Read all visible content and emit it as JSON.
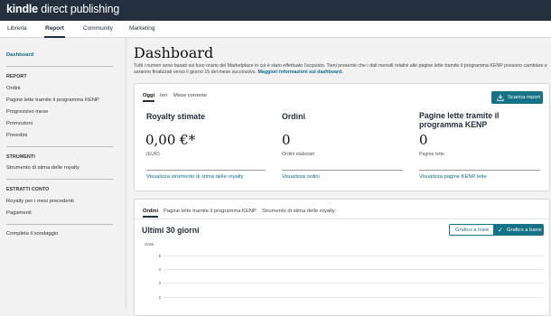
{
  "brand": {
    "bold": "kindle",
    "rest": " direct publishing"
  },
  "nav": {
    "tabs": [
      {
        "label": "Libreria"
      },
      {
        "label": "Report"
      },
      {
        "label": "Community"
      },
      {
        "label": "Marketing"
      }
    ],
    "active": "Report"
  },
  "sidebar": {
    "dashboard": "Dashboard",
    "report_heading": "REPORT",
    "report_items": [
      "Ordini",
      "Pagine lette tramite il programma KENP",
      "Progressivo mese",
      "Promozioni",
      "Preordini"
    ],
    "tools_heading": "STRUMENTI",
    "tools_items": [
      "Strumento di stima delle royalty"
    ],
    "statements_heading": "ESTRATTI CONTO",
    "statements_items": [
      "Royalty per i mesi precedenti",
      "Pagamenti"
    ],
    "survey": "Completa il sondaggio"
  },
  "main": {
    "title": "Dashboard",
    "intro": "Tutti i numeri sono basati sul fuso orario del Marketplace in cui è stato effettuato l'acquisto. Tieni presente che i dati mensili relativi alle pagine lette tramite il programma KENP possono cambiare e saranno finalizzati verso il giorno 15 del mese successivo.",
    "intro_link": "Maggiori informazioni sul dashboard."
  },
  "summary": {
    "tabs": [
      "Oggi",
      "Ieri",
      "Mese corrente"
    ],
    "download": "Scarica report",
    "metrics": [
      {
        "title": "Royalty stimate",
        "value": "0,00 €*",
        "sub": "(EUR)",
        "link": "Visualizza strumento di stima delle royalty"
      },
      {
        "title": "Ordini",
        "value": "0",
        "sub": "Ordini elaborati",
        "link": "Visualizza ordini"
      },
      {
        "title": "Pagine lette tramite il programma KENP",
        "value": "0",
        "sub": "Pagine lette",
        "link": "Visualizza pagine KENP lette"
      }
    ]
  },
  "chart_panel": {
    "tabs": [
      "Ordini",
      "Pagine lette tramite il programma KENP",
      "Strumento di stima delle royalty"
    ],
    "title": "Ultimi 30 giorni",
    "toggle_line": "Grafico a linee",
    "toggle_bar": "Grafico a barre"
  },
  "chart_data": {
    "type": "bar",
    "title": "Ultimi 30 giorni",
    "ylabel": "Unità",
    "yticks": [
      "5",
      "4",
      "3",
      "2"
    ],
    "series": []
  },
  "colors": {
    "topbar": "#232f3e",
    "accent": "#167287",
    "link": "#0f6c89"
  }
}
